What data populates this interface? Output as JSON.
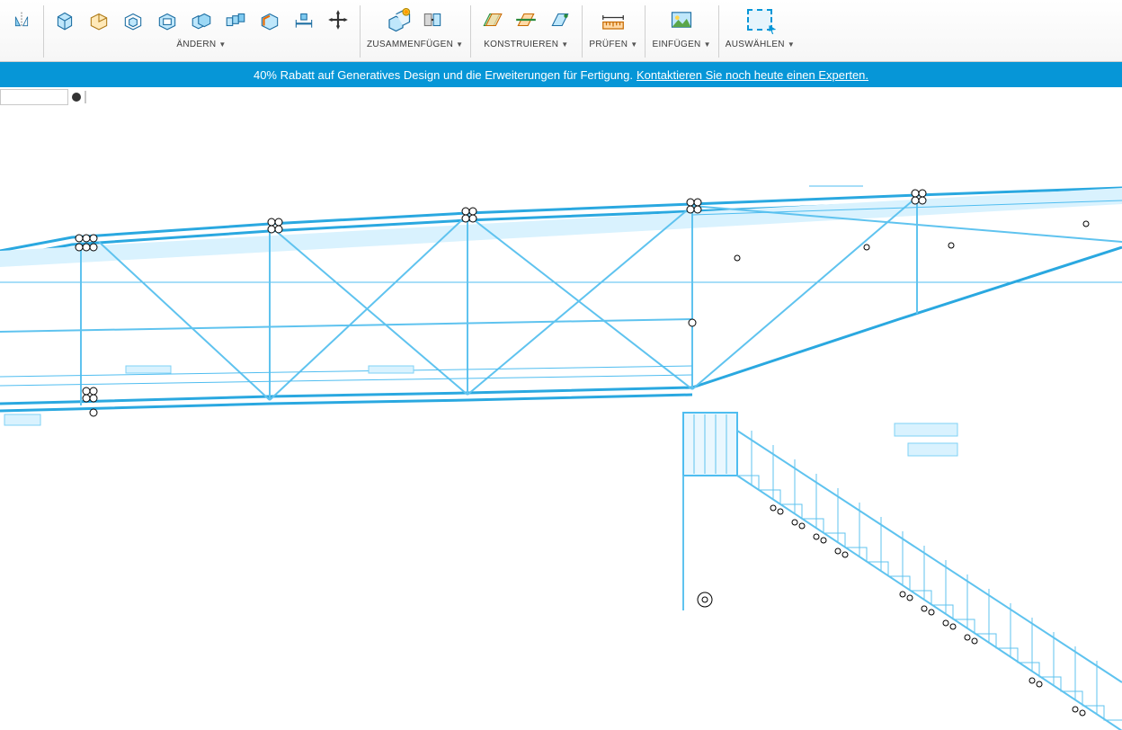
{
  "ribbon": {
    "panels": [
      {
        "label": "ÄNDERN"
      },
      {
        "label": "ZUSAMMENFÜGEN"
      },
      {
        "label": "KONSTRUIEREN"
      },
      {
        "label": "PRÜFEN"
      },
      {
        "label": "EINFÜGEN"
      },
      {
        "label": "AUSWÄHLEN"
      }
    ],
    "icons": {
      "mirror": "mirror",
      "box1": "box3d",
      "box2": "box3d",
      "box3": "box3d",
      "box4": "box3d",
      "box5": "box3d",
      "box6": "box3d",
      "box7": "box3d",
      "ruler": "dim",
      "move": "move4",
      "combine": "combine",
      "split": "split",
      "plane1": "plane-green",
      "plane2": "plane-orange",
      "plane3": "plane-cyan",
      "measure": "measure",
      "image": "insert-image",
      "select": "select-rect"
    }
  },
  "promo": {
    "prefix": "40% Rabatt auf Generatives Design und die Erweiterungen für Fertigung.",
    "link": "Kontaktieren Sie noch heute einen Experten."
  }
}
